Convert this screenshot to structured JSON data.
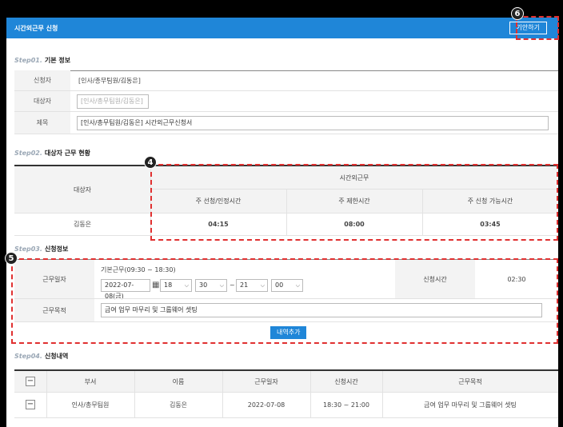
{
  "header": {
    "title": "시간외근무 신청",
    "draft_button": "기안하기"
  },
  "step1": {
    "num": "Step01.",
    "title": "기본 정보",
    "applicant_label": "신청자",
    "applicant_value": "[인사/총무팀원/김동은]",
    "target_label": "대상자",
    "target_placeholder": "[인사/총무팀원/김동은]",
    "subject_label": "제목",
    "subject_value": "[인사/총무팀원/김동은] 시간외근무신청서"
  },
  "step2": {
    "num": "Step02.",
    "title": "대상자 근무 현황",
    "col_target": "대상자",
    "group_header": "시간외근무",
    "col_applied": "주 선청/인정시간",
    "col_limit": "주 제한시간",
    "col_available": "주 신청 가능시간",
    "row": {
      "name": "김동은",
      "applied": "04:15",
      "limit": "08:00",
      "available": "03:45"
    }
  },
  "step3": {
    "num": "Step03.",
    "title": "신청정보",
    "workdate_label": "근무일자",
    "basic_hours": "기본근무(09:30 ~ 18:30)",
    "date_value": "2022-07-08(금)",
    "start_hour": "18",
    "start_min": "30",
    "tilde": "~",
    "end_hour": "21",
    "end_min": "00",
    "apply_time_label": "신청시간",
    "apply_time_value": "02:30",
    "purpose_label": "근무목적",
    "purpose_value": "금여 업무 마무리 및 그룹웨어 셋팅",
    "add_button": "내역추가"
  },
  "step4": {
    "num": "Step04.",
    "title": "신청내역",
    "headers": [
      "부서",
      "이름",
      "근무일자",
      "신청시간",
      "근무목적"
    ],
    "row": {
      "dept": "인사/총무팀원",
      "name": "김동은",
      "date": "2022-07-08",
      "time": "18:30 ~ 21:00",
      "purpose": "금여 업무 마무리 및 그룹웨어 셋팅"
    },
    "minus_symbol": "−"
  },
  "annotations": {
    "badge4": "4",
    "badge5": "5",
    "badge6": "6"
  },
  "colors": {
    "accent": "#1f86d8",
    "highlight": "#e03030"
  },
  "icons": {
    "calendar": "calendar-icon",
    "dropdown": "chevron-down-icon"
  }
}
